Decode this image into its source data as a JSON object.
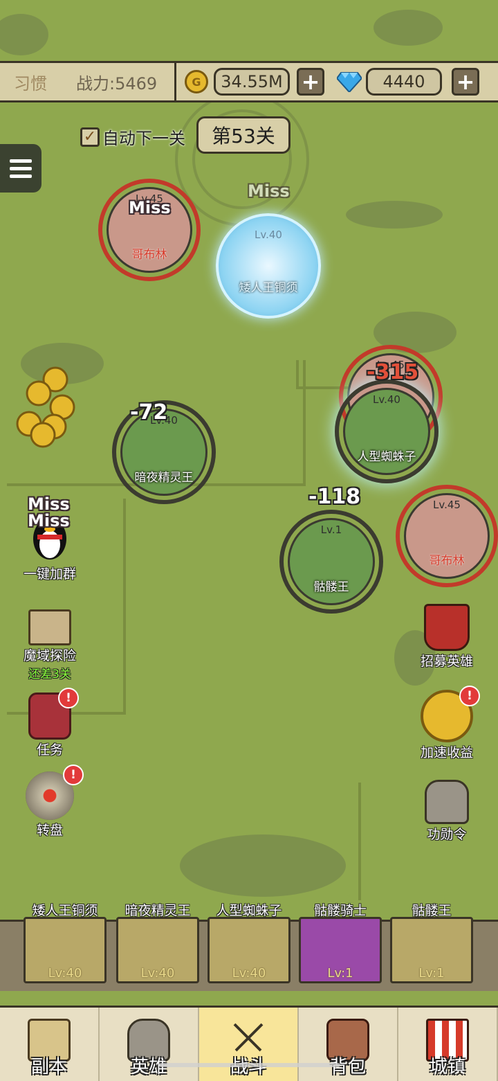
{
  "topbar": {
    "name": "习惯",
    "power": "战力:5469",
    "gold": "34.55M",
    "gems": "4440",
    "plus": "+"
  },
  "auto_next": {
    "label": "自动下一关",
    "checked": true
  },
  "stage": "第53关",
  "battle": {
    "enemies": [
      {
        "level": "Lv.45",
        "name": "哥布林"
      },
      {
        "level": "Lv.40",
        "name": "矮人王铜须"
      },
      {
        "level": "Lv.45",
        "name": "哥布林"
      },
      {
        "level": "Lv.45",
        "name": "哥布林"
      }
    ],
    "allies": [
      {
        "level": "Lv.40",
        "name": "暗夜精灵王"
      },
      {
        "level": "Lv.40",
        "name": "人型蜘蛛子"
      },
      {
        "level": "Lv.1",
        "name": "骷髅王"
      }
    ],
    "damage": [
      "-72",
      "-315",
      "-118"
    ],
    "miss": "Miss"
  },
  "side_left": {
    "qq": "一键加群",
    "explore": "魔域探险",
    "explore_sub": "还差3关",
    "quest": "任务",
    "wheel": "转盘"
  },
  "side_right": {
    "recruit": "招募英雄",
    "speed": "加速收益",
    "merit": "功勋令"
  },
  "badge": "!",
  "heroes": [
    {
      "name": "矮人王铜须",
      "level": "Lv:40"
    },
    {
      "name": "暗夜精灵王",
      "level": "Lv:40"
    },
    {
      "name": "人型蜘蛛子",
      "level": "Lv:40"
    },
    {
      "name": "骷髅骑士",
      "level": "Lv:1"
    },
    {
      "name": "骷髅王",
      "level": "Lv:1"
    }
  ],
  "nav": [
    "副本",
    "英雄",
    "战斗",
    "背包",
    "城镇"
  ],
  "colors": {
    "map": "#8fa84e",
    "enemy_ring": "#c23a2a",
    "ally_fill": "#6b9a4e",
    "nav_active": "#f8e59a"
  }
}
